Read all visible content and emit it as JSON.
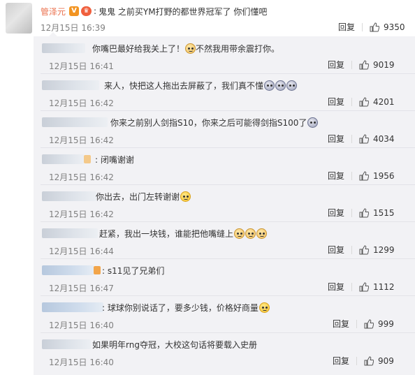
{
  "top_comment": {
    "username": "管泽元",
    "verified_badge": "V",
    "fan_badge": "♛",
    "content": "鬼鬼 之前买YM打野的都世界冠军了 你们懂吧",
    "time": "12月15日 16:39",
    "reply_label": "回复",
    "likes": "9350"
  },
  "replies": [
    {
      "text": "你嘴巴最好给我关上了！",
      "text2": "不然我用带余震打你。",
      "time": "12月15日 16:41",
      "reply_label": "回复",
      "likes": "9019"
    },
    {
      "text": "来人，快把这人拖出去屏蔽了，我们真不懂",
      "text2": "",
      "time": "12月15日 16:42",
      "reply_label": "回复",
      "likes": "4201"
    },
    {
      "text": "你来之前别人剑指S10，你来之后可能得剑指S100了",
      "text2": "",
      "time": "12月15日 16:42",
      "reply_label": "回复",
      "likes": "4034"
    },
    {
      "text": ": 闭嘴谢谢",
      "text2": "",
      "time": "12月15日 16:42",
      "reply_label": "回复",
      "likes": "1956"
    },
    {
      "text": "你出去，出门左转谢谢",
      "text2": "",
      "time": "12月15日 16:42",
      "reply_label": "回复",
      "likes": "1515"
    },
    {
      "text": "赶紧，我出一块钱，谁能把他嘴缝上",
      "text2": "",
      "time": "12月15日 16:44",
      "reply_label": "回复",
      "likes": "1299"
    },
    {
      "text": ": s11见了兄弟们",
      "text2": "",
      "time": "12月15日 16:47",
      "reply_label": "回复",
      "likes": "1112"
    },
    {
      "text": ": 球球你别说话了，要多少钱，价格好商量",
      "text2": "",
      "time": "12月15日 16:40",
      "reply_label": "回复",
      "likes": "999"
    },
    {
      "text": "如果明年rng夺冠，大校这句话将要载入史册",
      "text2": "",
      "time": "12月15日 16:40",
      "reply_label": "回复",
      "likes": "909"
    }
  ],
  "icons": {
    "thumb": "thumb-up-icon",
    "emoji_yellow": "smile-emoji-icon",
    "emoji_cat": "cat-emoji-icon",
    "emoji_cry": "cry-emoji-icon"
  },
  "colors": {
    "username": "#eb7350",
    "panel_bg": "#f2f2f5",
    "meta_gray": "#808080"
  }
}
